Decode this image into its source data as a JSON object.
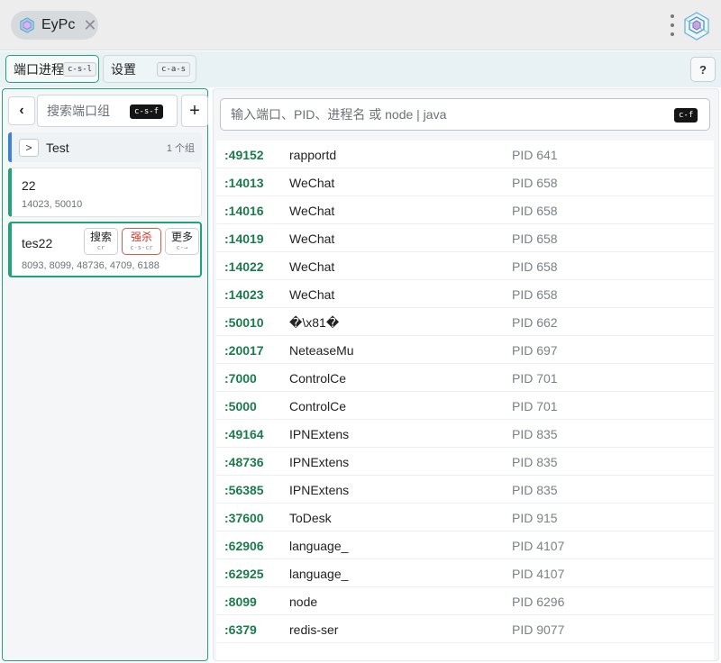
{
  "app": {
    "title": "EyPc",
    "close_symbol": "✕",
    "menu_icon": "kebab-menu-icon",
    "logo_icon": "app-logo-icon"
  },
  "tabs": [
    {
      "label": "端口进程",
      "shortcut": "c-s-l",
      "active": true
    },
    {
      "label": "设置",
      "shortcut": "c-a-s",
      "active": false
    }
  ],
  "help_label": "?",
  "groups": {
    "back_label": "‹",
    "search_placeholder": "搜索端口组",
    "search_shortcut": "c-s-f",
    "add_label": "+",
    "folder": {
      "expand_label": ">",
      "name": "Test",
      "count": "1 个组"
    },
    "items": [
      {
        "name": "22",
        "ports": "14023, 50010"
      },
      {
        "name": "tes22",
        "ports": "8093, 8099, 48736, 4709, 6188",
        "actions": [
          {
            "label": "搜索",
            "hint": "cr"
          },
          {
            "label": "强杀",
            "hint": "c-s-cr"
          },
          {
            "label": "更多",
            "hint": "c-→"
          }
        ]
      }
    ]
  },
  "ports": {
    "search_placeholder": "输入端口、PID、进程名 或 node | java",
    "search_shortcut": "c-f",
    "rows": [
      {
        "port": ":49152",
        "process": "rapportd",
        "pid": "PID 641"
      },
      {
        "port": ":14013",
        "process": "WeChat",
        "pid": "PID 658"
      },
      {
        "port": ":14016",
        "process": "WeChat",
        "pid": "PID 658"
      },
      {
        "port": ":14019",
        "process": "WeChat",
        "pid": "PID 658"
      },
      {
        "port": ":14022",
        "process": "WeChat",
        "pid": "PID 658"
      },
      {
        "port": ":14023",
        "process": "WeChat",
        "pid": "PID 658"
      },
      {
        "port": ":50010",
        "process": "�\\x81�",
        "pid": "PID 662"
      },
      {
        "port": ":20017",
        "process": "NeteaseMu",
        "pid": "PID 697"
      },
      {
        "port": ":7000",
        "process": "ControlCe",
        "pid": "PID 701"
      },
      {
        "port": ":5000",
        "process": "ControlCe",
        "pid": "PID 701"
      },
      {
        "port": ":49164",
        "process": "IPNExtens",
        "pid": "PID 835"
      },
      {
        "port": ":48736",
        "process": "IPNExtens",
        "pid": "PID 835"
      },
      {
        "port": ":56385",
        "process": "IPNExtens",
        "pid": "PID 835"
      },
      {
        "port": ":37600",
        "process": "ToDesk",
        "pid": "PID 915"
      },
      {
        "port": ":62906",
        "process": "language_",
        "pid": "PID 4107"
      },
      {
        "port": ":62925",
        "process": "language_",
        "pid": "PID 4107"
      },
      {
        "port": ":8099",
        "process": "node",
        "pid": "PID 6296"
      },
      {
        "port": ":6379",
        "process": "redis-ser",
        "pid": "PID 9077"
      }
    ]
  },
  "colors": {
    "accent": "#20a27a",
    "port_text": "#1d7a4f",
    "danger": "#c8372b",
    "folder_accent": "#3b82e0"
  }
}
